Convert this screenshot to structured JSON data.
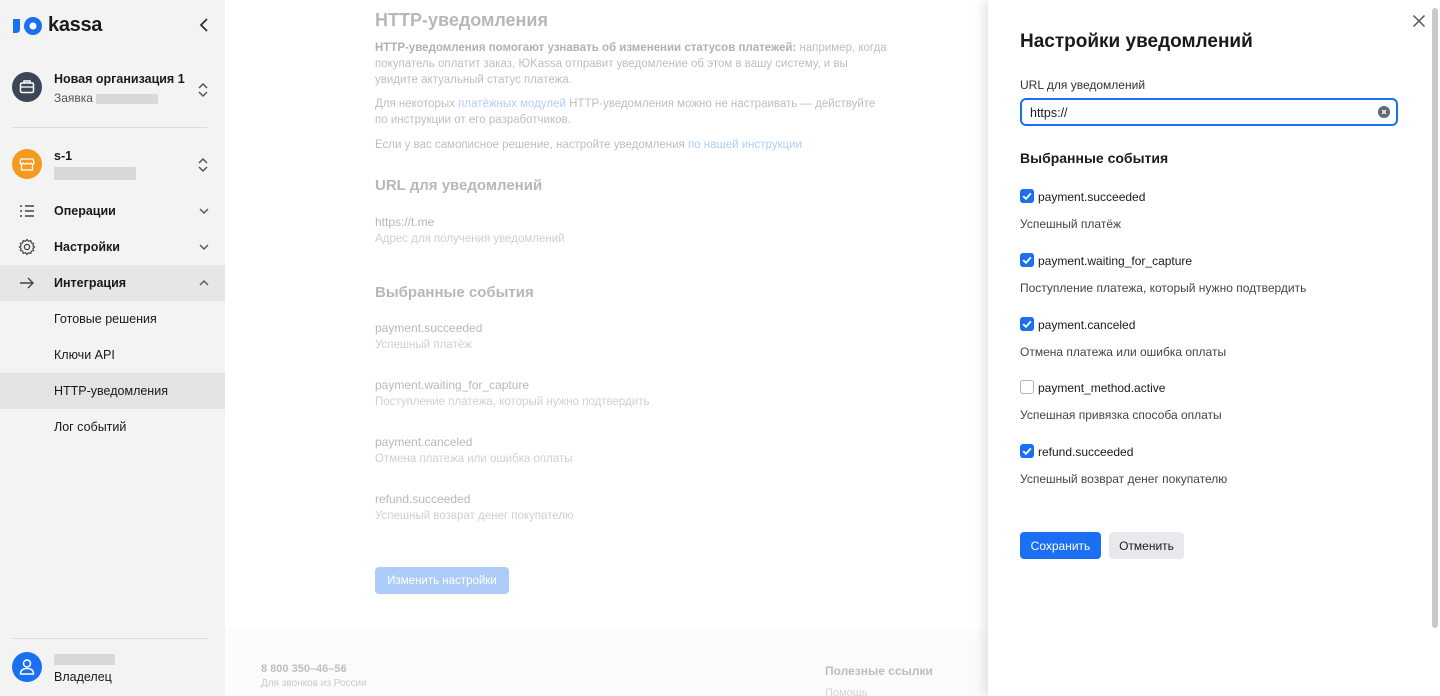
{
  "sidebar": {
    "logo_text": "kassa",
    "org": {
      "name": "Новая организация 1",
      "sub": "Заявка"
    },
    "shop": {
      "name": "s-1"
    },
    "nav": [
      {
        "label": "Операции",
        "icon": "list-icon"
      },
      {
        "label": "Настройки",
        "icon": "gear-icon"
      },
      {
        "label": "Интеграция",
        "icon": "arrow-right-icon"
      }
    ],
    "sub_items": [
      {
        "label": "Готовые решения"
      },
      {
        "label": "Ключи API"
      },
      {
        "label": "HTTP-уведомления"
      },
      {
        "label": "Лог событий"
      }
    ],
    "user_role": "Владелец"
  },
  "main": {
    "title": "HTTP-уведомления",
    "intro_bold": "HTTP-уведомления помогают узнавать об изменении статусов платежей:",
    "intro_rest": " например, когда покупатель оплатит заказ, ЮKassa отправит уведомление об этом в вашу систему, и вы увидите актуальный статус платежа.",
    "modules_pre": "Для некоторых ",
    "modules_link": "платёжных модулей",
    "modules_post": " HTTP-уведомления можно не настраивать — действуйте по инструкции от его разработчиков.",
    "custom_pre": "Если у вас самописное решение, настройте уведомления ",
    "custom_link": "по нашей инструкции",
    "url_heading": "URL для уведомлений",
    "url_value": "https://t.me",
    "url_hint": "Адрес для получения уведомлений",
    "events_heading": "Выбранные события",
    "events": [
      {
        "name": "payment.succeeded",
        "desc": "Успешный платёж"
      },
      {
        "name": "payment.waiting_for_capture",
        "desc": "Поступление платежа, который нужно подтвердить"
      },
      {
        "name": "payment.canceled",
        "desc": "Отмена платежа или ошибка оплаты"
      },
      {
        "name": "refund.succeeded",
        "desc": "Успешный возврат денег покупателю"
      }
    ],
    "edit_button": "Изменить настройки",
    "footer": {
      "phone": "8 800 350–46–56",
      "phone_sub": "Для звонков из России",
      "links_heading": "Полезные ссылки",
      "help": "Помощь"
    }
  },
  "panel": {
    "title": "Настройки уведомлений",
    "url_label": "URL для уведомлений",
    "url_value": "https://",
    "events_heading": "Выбранные события",
    "events": [
      {
        "name": "payment.succeeded",
        "desc": "Успешный платёж",
        "checked": true
      },
      {
        "name": "payment.waiting_for_capture",
        "desc": "Поступление платежа, который нужно подтвердить",
        "checked": true
      },
      {
        "name": "payment.canceled",
        "desc": "Отмена платежа или ошибка оплаты",
        "checked": true
      },
      {
        "name": "payment_method.active",
        "desc": "Успешная привязка способа оплаты",
        "checked": false
      },
      {
        "name": "refund.succeeded",
        "desc": "Успешный возврат денег покупателю",
        "checked": true
      }
    ],
    "save_label": "Сохранить",
    "cancel_label": "Отменить"
  },
  "colors": {
    "accent": "#1a6ff2",
    "shop_avatar": "#f59a1f",
    "org_avatar": "#3b4656"
  }
}
